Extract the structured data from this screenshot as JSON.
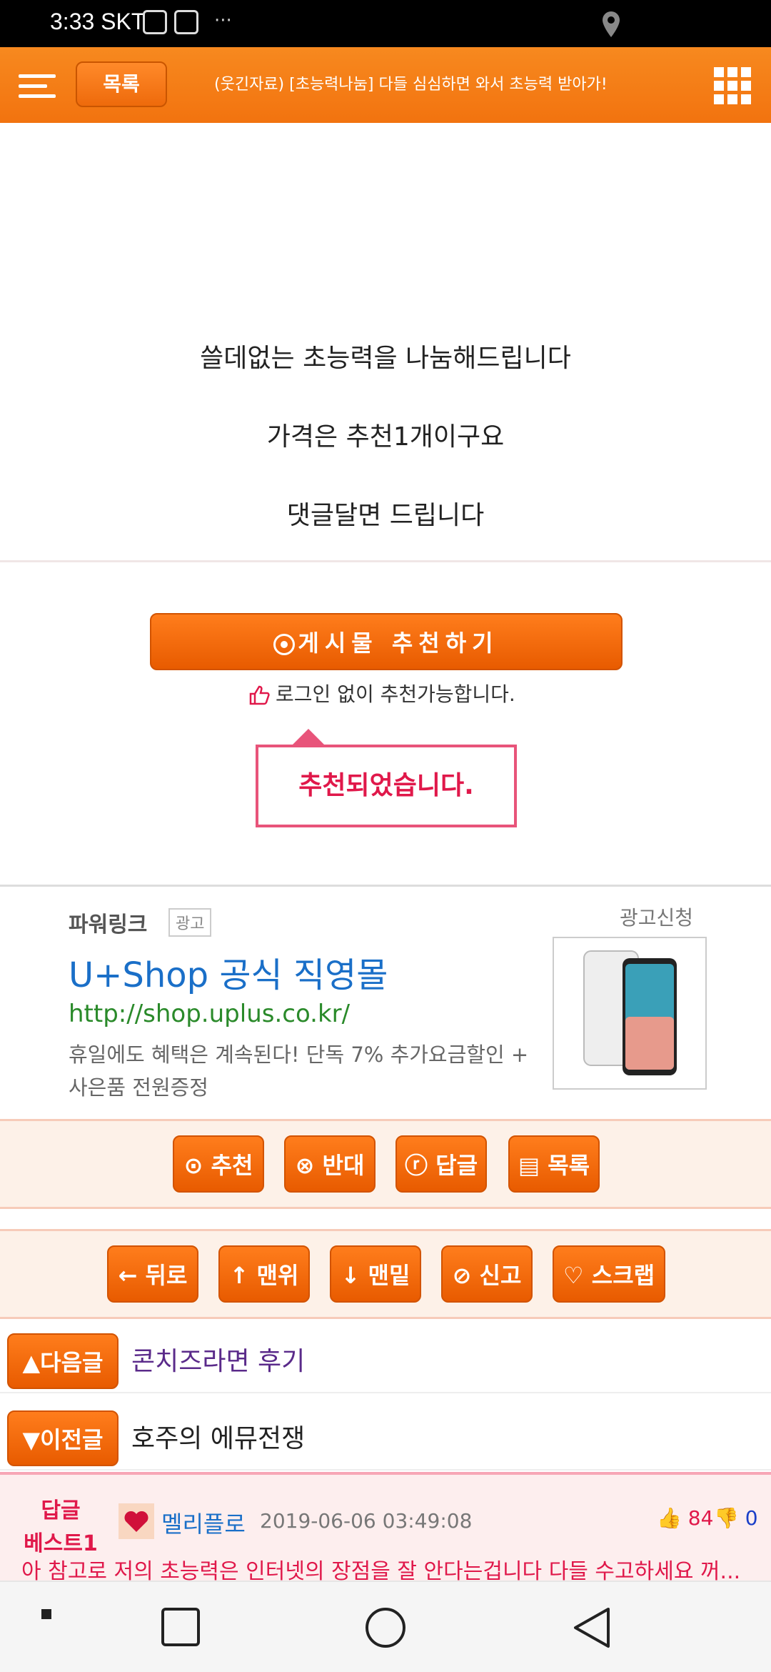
{
  "status_bar": {
    "time": "3:33 SKT",
    "more": "···"
  },
  "toolbar": {
    "list_button": "목록",
    "title": "(웃긴자료) [초능력나눔] 다들 심심하면 와서 초능력 받아가!"
  },
  "post": {
    "lines": [
      "쓸데없는 초능력을 나눔해드립니다",
      "가격은 추천1개이구요",
      "댓글달면 드립니다"
    ]
  },
  "recommend": {
    "button_label": "게시물 추천하기",
    "no_login_note": "로그인 없이 추천가능합니다.",
    "popup_text": "추천되었습니다."
  },
  "ad": {
    "powerlink": "파워링크",
    "badge": "광고",
    "apply": "광고신청",
    "title": "U+Shop 공식 직영몰",
    "url": "http://shop.uplus.co.kr/",
    "description": "휴일에도 혜택은 계속된다! 단독 7% 추가요금할인 + 사은품 전원증정"
  },
  "action_row_1": [
    "추천",
    "반대",
    "답글",
    "목록"
  ],
  "action_row_2": [
    "← 뒤로",
    "↑ 맨위",
    "↓ 맨밑",
    "신고",
    "스크랩"
  ],
  "next_post": {
    "label": "다음글",
    "title": "콘치즈라면 후기"
  },
  "prev_post": {
    "label": "이전글",
    "title": "호주의 에뮤전쟁"
  },
  "best_reply": {
    "badge_line1": "답글",
    "badge_line2": "베스트1",
    "author": "멜리플로",
    "date": "2019-06-06 03:49:08",
    "up_count": "84",
    "down_count": "0",
    "body": "아 참고로 저의 초능력은 인터넷의 장점을 잘 안다는겁니다 다들 수고하세요 꺼..."
  },
  "colors": {
    "accent": "#f2730f",
    "popup": "#e0184a",
    "link": "#1a6fc8"
  }
}
